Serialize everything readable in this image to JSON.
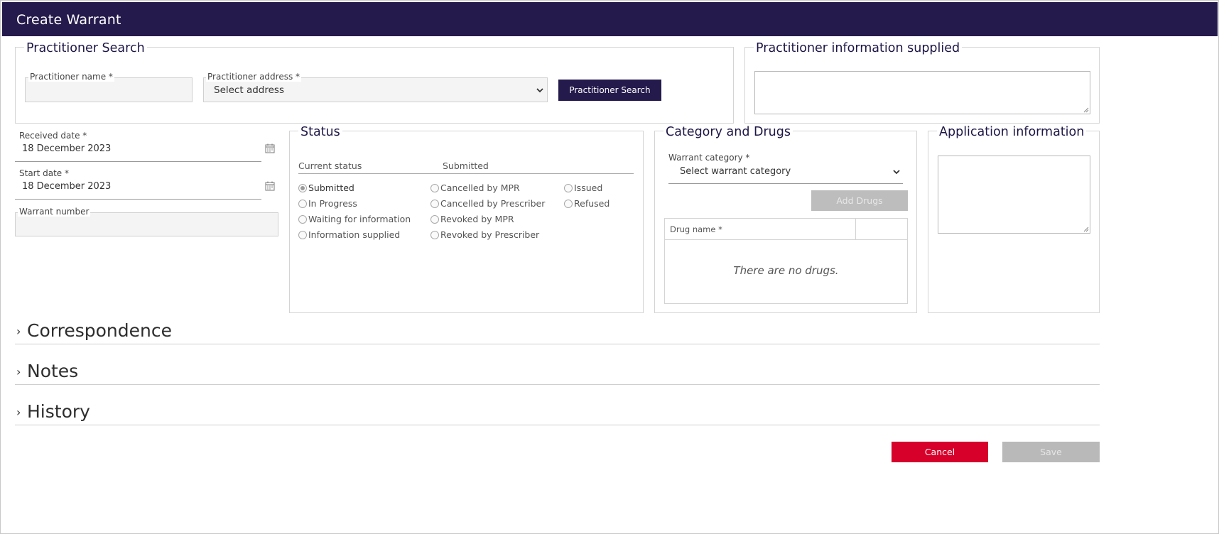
{
  "window": {
    "title": "Create Warrant"
  },
  "practitioner_search": {
    "legend": "Practitioner Search",
    "name_label": "Practitioner name *",
    "name_value": "",
    "address_label": "Practitioner address *",
    "address_value": "Select address",
    "search_button": "Practitioner Search"
  },
  "practitioner_info": {
    "legend": "Practitioner information supplied",
    "value": ""
  },
  "dates": {
    "received_label": "Received date *",
    "received_value": "18 December 2023",
    "start_label": "Start date *",
    "start_value": "18 December 2023",
    "warrant_number_label": "Warrant number",
    "warrant_number_value": ""
  },
  "status": {
    "legend": "Status",
    "current_label": "Current status",
    "current_value": "Submitted",
    "options": [
      {
        "label": "Submitted",
        "checked": true
      },
      {
        "label": "In Progress",
        "checked": false
      },
      {
        "label": "Waiting for information",
        "checked": false
      },
      {
        "label": "Information supplied",
        "checked": false
      },
      {
        "label": "Cancelled by MPR",
        "checked": false
      },
      {
        "label": "Cancelled by Prescriber",
        "checked": false
      },
      {
        "label": "Revoked by MPR",
        "checked": false
      },
      {
        "label": "Revoked by Prescriber",
        "checked": false
      },
      {
        "label": "Issued",
        "checked": false
      },
      {
        "label": "Refused",
        "checked": false
      }
    ]
  },
  "category": {
    "legend": "Category and Drugs",
    "warrant_category_label": "Warrant category *",
    "warrant_category_value": "Select warrant category",
    "add_drugs_button": "Add Drugs",
    "drug_name_header": "Drug name *",
    "empty_text": "There are no drugs."
  },
  "application": {
    "legend": "Application information",
    "value": ""
  },
  "sections": [
    {
      "title": "Correspondence",
      "icon": "chevron-right-icon"
    },
    {
      "title": "Notes",
      "icon": "chevron-right-icon"
    },
    {
      "title": "History",
      "icon": "chevron-right-icon"
    }
  ],
  "actions": {
    "cancel": "Cancel",
    "save": "Save"
  },
  "colors": {
    "header_bg": "#251a4c",
    "primary_button": "#251a4c",
    "cancel_button": "#d6002a",
    "disabled_button": "#b9b9b9"
  }
}
